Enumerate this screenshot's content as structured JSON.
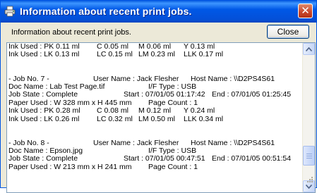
{
  "window": {
    "title": "Information about recent print jobs.",
    "caption": "Information about recent print jobs.",
    "close_label": "Close",
    "title_close_glyph": "✕"
  },
  "icons": {
    "app": "printer-icon",
    "title_close": "close-icon",
    "scroll_up": "arrow-up-icon",
    "scroll_down": "arrow-down-icon"
  },
  "log": {
    "top_lines": [
      {
        "a": "Ink Used : PK 0.11 ml",
        "b": "C 0.05 ml",
        "c": "M 0.06 ml",
        "d": "Y 0.13 ml"
      },
      {
        "a": "Ink Used : LK 0.13 ml",
        "b": "LC 0.15 ml",
        "c": "LM 0.23 ml",
        "d": "LLK 0.17 ml"
      }
    ],
    "job7": {
      "job_no": "- Job No. 7 -",
      "user": "User Name : Jack Flesher",
      "host": "Host Name : \\\\D2PS4S61",
      "doc": "Doc Name : Lab Test Page.tif",
      "if_type": "I/F Type : USB",
      "state": "Job State : Complete",
      "start": "Start : 07/01/05 01:17:42",
      "end": "End : 07/01/05 01:25:45",
      "paper": "Paper Used : W 328 mm x H 445 mm",
      "count": "Page Count : 1",
      "ink1": {
        "a": "Ink Used : PK 0.28 ml",
        "b": "C 0.08 ml",
        "c": "M 0.12 ml",
        "d": "Y 0.24 ml"
      },
      "ink2": {
        "a": "Ink Used : LK 0.26 ml",
        "b": "LC 0.32 ml",
        "c": "LM 0.50 ml",
        "d": "LLK 0.34 ml"
      }
    },
    "job8": {
      "job_no": "- Job No. 8 -",
      "user": "User Name : Jack Flesher",
      "host": "Host Name : \\\\D2PS4S61",
      "doc": "Doc Name : Epson.jpg",
      "if_type": "I/F Type : USB",
      "state": "Job State : Complete",
      "start": "Start : 07/01/05 00:47:51",
      "end": "End : 07/01/05 00:51:54",
      "paper": "Paper Used : W 213 mm x H 241 mm",
      "count": "Page Count : 1"
    }
  },
  "colors": {
    "titlebar": "#0058e6",
    "close_red": "#c8452a",
    "panel_border": "#7f9db9",
    "dialog_bg": "#ece9d8"
  }
}
